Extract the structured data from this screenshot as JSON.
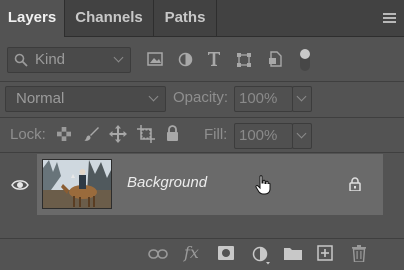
{
  "tabs": [
    {
      "label": "Layers",
      "active": true
    },
    {
      "label": "Channels",
      "active": false
    },
    {
      "label": "Paths",
      "active": false
    }
  ],
  "filter": {
    "value": "Kind",
    "icons": [
      "image-filter-icon",
      "adjustment-filter-icon",
      "type-filter-icon",
      "shape-filter-icon",
      "smart-object-filter-icon",
      "filter-toggle-icon"
    ]
  },
  "blend": {
    "mode": "Normal",
    "opacity_label": "Opacity:",
    "opacity_value": "100%"
  },
  "lock": {
    "label": "Lock:",
    "fill_label": "Fill:",
    "fill_value": "100%",
    "icons": [
      "lock-transparent-pixels-icon",
      "lock-image-pixels-icon",
      "lock-position-icon",
      "lock-artboard-icon",
      "lock-all-icon"
    ]
  },
  "layers": [
    {
      "name": "Background",
      "visible": true,
      "locked": true
    }
  ],
  "bottom_icons": [
    "link-layers-icon",
    "fx-icon",
    "add-mask-icon",
    "adjustment-layer-icon",
    "new-group-icon",
    "new-layer-icon",
    "delete-layer-icon"
  ],
  "fx_text": "fx"
}
